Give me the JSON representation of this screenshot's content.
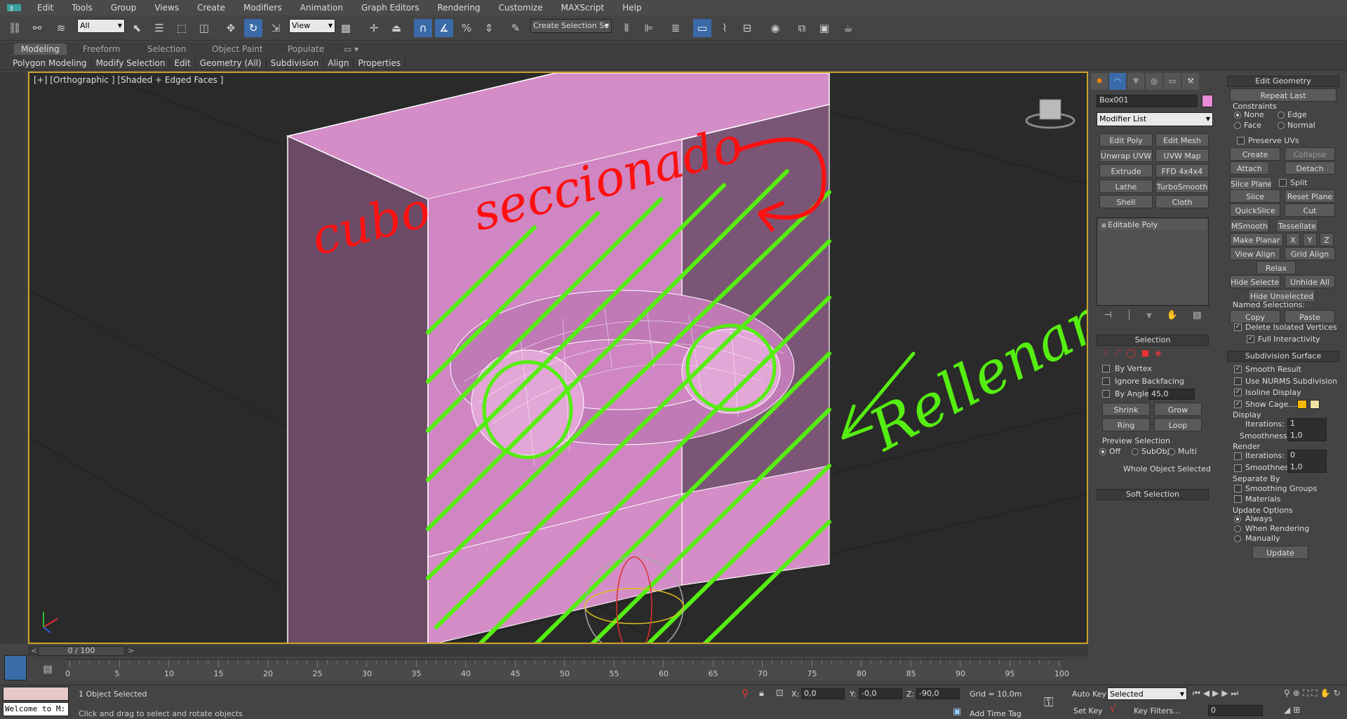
{
  "menu": [
    "Edit",
    "Tools",
    "Group",
    "Views",
    "Create",
    "Modifiers",
    "Animation",
    "Graph Editors",
    "Rendering",
    "Customize",
    "MAXScript",
    "Help"
  ],
  "toolbar": {
    "filter": "All",
    "refcoord": "View",
    "selset": "Create Selection Se"
  },
  "ribbon_tabs": [
    "Modeling",
    "Freeform",
    "Selection",
    "Object Paint",
    "Populate"
  ],
  "ribbon_items": [
    "Polygon Modeling",
    "Modify Selection",
    "Edit",
    "Geometry (All)",
    "Subdivision",
    "Align",
    "Properties"
  ],
  "viewport": {
    "label": "[+] [Orthographic ] [Shaded + Edged Faces ]"
  },
  "annotations": {
    "a1": "cubo",
    "a2": "seccionado",
    "a3": "Rellenar"
  },
  "colors": {
    "object": "#cf86c2",
    "object_side": "#6b4a66",
    "annotation_red": "#ff1010",
    "annotation_green": "#55ee10",
    "viewport_border": "#c8a22a"
  },
  "cmd": {
    "object_name": "Box001",
    "modifier_list": "Modifier List",
    "mod_buttons": [
      "Edit Poly",
      "Edit Mesh",
      "Unwrap UVW",
      "UVW Map",
      "Extrude",
      "FFD 4x4x4",
      "Lathe",
      "TurboSmooth",
      "Shell",
      "Cloth"
    ],
    "stack_item": "Editable Poly",
    "selection": {
      "title": "Selection",
      "by_vertex": "By Vertex",
      "ignore_backfacing": "Ignore Backfacing",
      "by_angle": "By Angle:",
      "angle": "45,0",
      "shrink": "Shrink",
      "grow": "Grow",
      "ring": "Ring",
      "loop": "Loop",
      "preview": "Preview Selection",
      "off": "Off",
      "subobj": "SubObj",
      "multi": "Multi",
      "whole": "Whole Object Selected"
    },
    "soft_selection": "Soft Selection"
  },
  "edit_geometry": {
    "title": "Edit Geometry",
    "repeat_last": "Repeat Last",
    "constraints": "Constraints",
    "none": "None",
    "edge": "Edge",
    "face": "Face",
    "normal": "Normal",
    "preserve_uvs": "Preserve UVs",
    "create": "Create",
    "collapse": "Collapse",
    "attach": "Attach",
    "detach": "Detach",
    "slice_plane": "Slice Plane",
    "split": "Split",
    "slice": "Slice",
    "reset_plane": "Reset Plane",
    "quickslice": "QuickSlice",
    "cut": "Cut",
    "msmooth": "MSmooth",
    "tessellate": "Tessellate",
    "make_planar": "Make Planar",
    "x": "X",
    "y": "Y",
    "z": "Z",
    "view_align": "View Align",
    "grid_align": "Grid Align",
    "relax": "Relax",
    "hide_selected": "Hide Selected",
    "unhide_all": "Unhide All",
    "hide_unselected": "Hide Unselected",
    "named_selections": "Named Selections:",
    "copy": "Copy",
    "paste": "Paste",
    "delete_isolated": "Delete Isolated Vertices",
    "full_interactivity": "Full Interactivity"
  },
  "subdivision": {
    "title": "Subdivision Surface",
    "smooth_result": "Smooth Result",
    "use_nurms": "Use NURMS Subdivision",
    "isoline": "Isoline Display",
    "show_cage": "Show Cage......",
    "display": "Display",
    "iterations": "Iterations:",
    "iter_val": "1",
    "smoothness": "Smoothness:",
    "smooth_val": "1,0",
    "render": "Render",
    "r_iter_val": "0",
    "r_smooth_val": "1,0",
    "separate_by": "Separate By",
    "smoothing_groups": "Smoothing Groups",
    "materials": "Materials",
    "update_options": "Update Options",
    "always": "Always",
    "when_rendering": "When Rendering",
    "manually": "Manually",
    "update": "Update"
  },
  "timeline": {
    "frame": "0 / 100",
    "ticks": [
      "0",
      "5",
      "10",
      "15",
      "20",
      "25",
      "30",
      "35",
      "40",
      "45",
      "50",
      "55",
      "60",
      "65",
      "70",
      "75",
      "80",
      "85",
      "90",
      "95",
      "100"
    ]
  },
  "status": {
    "welcome": "Welcome to M:",
    "selected": "1 Object Selected",
    "prompt": "Click and drag to select and rotate objects",
    "x": "0,0",
    "y": "-0,0",
    "z": "-90,0",
    "grid": "Grid = 10,0m",
    "add_time_tag": "Add Time Tag",
    "auto_key": "Auto Key",
    "set_key": "Set Key",
    "key_mode": "Selected",
    "key_filters": "Key Filters...",
    "frame_val": "0",
    "x_lbl": "X:",
    "y_lbl": "Y:",
    "z_lbl": "Z:"
  }
}
